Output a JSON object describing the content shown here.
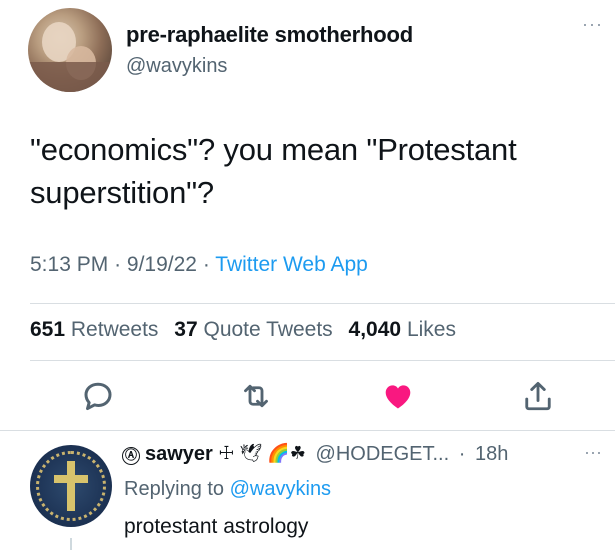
{
  "tweet": {
    "display_name": "pre-raphaelite smotherhood",
    "handle": "@wavykins",
    "more": "···",
    "text_line1": "\"economics\"? you mean \"Protestant",
    "text_line2": "superstition\"?",
    "time": "5:13 PM",
    "date": "9/19/22",
    "source": "Twitter Web App",
    "separator": "·"
  },
  "stats": {
    "retweets_count": "651",
    "retweets_label": "Retweets",
    "quotes_count": "37",
    "quotes_label": "Quote Tweets",
    "likes_count": "4,040",
    "likes_label": "Likes"
  },
  "actions": {
    "reply_icon": "reply-icon",
    "retweet_icon": "retweet-icon",
    "like_icon": "heart-icon",
    "share_icon": "share-icon",
    "like_color": "#f91880",
    "icon_color": "#536471"
  },
  "reply": {
    "anarchy_symbol": "Ⓐ",
    "display_name": "sawyer",
    "name_emoji": "☩ 🕊 🌈☘",
    "handle": "@HODEGET...",
    "time": "18h",
    "more": "···",
    "replying_prefix": "Replying to",
    "replying_mention": "@wavykins",
    "text": "protestant astrology"
  }
}
